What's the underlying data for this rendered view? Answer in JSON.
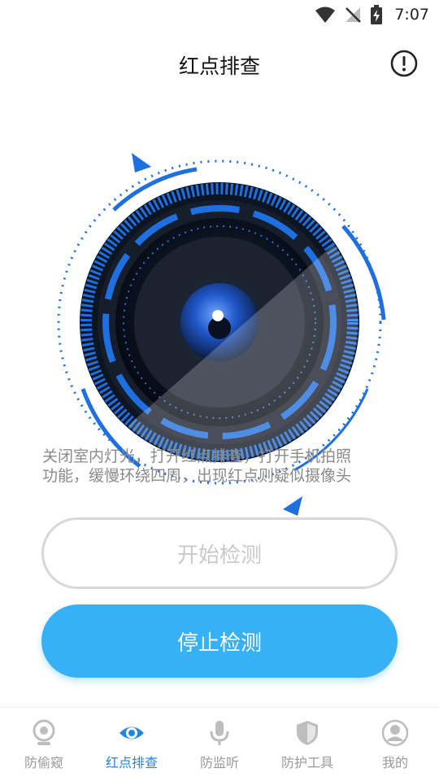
{
  "status": {
    "time": "7:07"
  },
  "header": {
    "title": "红点排查"
  },
  "hint": {
    "line1": "关闭室内灯光，打开红点排查，打开手机拍照",
    "line2": "功能，缓慢环绕四周，出现红点则疑似摄像头"
  },
  "buttons": {
    "start": "开始检测",
    "stop": "停止检测"
  },
  "nav": {
    "items": [
      {
        "label": "防偷窥",
        "icon": "webcam-icon"
      },
      {
        "label": "红点排查",
        "icon": "eye-icon"
      },
      {
        "label": "防监听",
        "icon": "microphone-icon"
      },
      {
        "label": "防护工具",
        "icon": "shield-icon"
      },
      {
        "label": "我的",
        "icon": "user-icon"
      }
    ],
    "active_index": 1
  },
  "colors": {
    "accent": "#38b0f5",
    "active_nav": "#1f86e6",
    "scanner_blue": "#1e6fe0"
  }
}
